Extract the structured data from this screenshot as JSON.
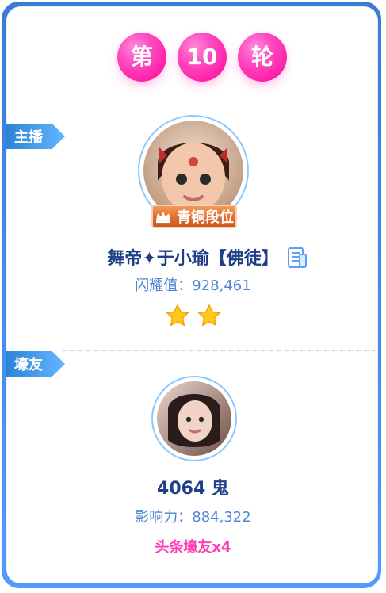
{
  "round": {
    "prefix": "第",
    "number": "10",
    "suffix": "轮"
  },
  "labels": {
    "host": "主播",
    "fan": "壕友"
  },
  "host": {
    "badge": "青铜段位",
    "name": "舞帝✦于小瑜【佛徒】",
    "metric": "闪耀值：928,461",
    "stars": 2
  },
  "fan": {
    "name": "4064 鬼",
    "metric": "影响力：884,322",
    "tag": "头条壕友x4"
  },
  "colors": {
    "frame": "#3a7bd5",
    "tag": "#2d83d6",
    "pill": "#ff2aa9",
    "name": "#1f3f86",
    "metric": "#4f86d6",
    "fan_tag": "#ff3fb7",
    "badge": "#e26d2a"
  },
  "icons": {
    "crown": "crown-icon",
    "document": "document-icon",
    "star": "star-icon"
  }
}
